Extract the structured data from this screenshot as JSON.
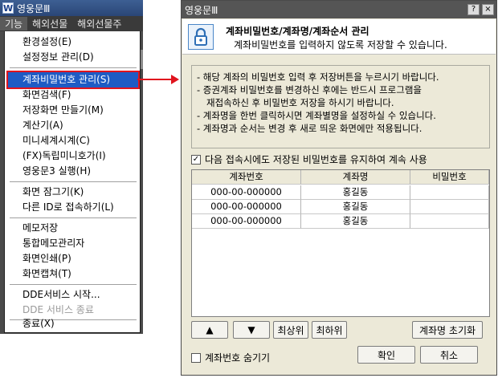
{
  "app": {
    "title": "영웅문Ⅲ",
    "logo": "W",
    "menubar": [
      "기능",
      "해외선물",
      "해외선물주"
    ],
    "menu_items": [
      {
        "label": "환경설정(E)",
        "key": "env"
      },
      {
        "label": "설정정보 관리(D)",
        "key": "config"
      },
      {
        "label": "계좌비밀번호 관리(S)",
        "key": "acct-pw",
        "selected": true
      },
      {
        "label": "화면검색(F)",
        "key": "screen-search"
      },
      {
        "label": "저장화면 만들기(M)",
        "key": "save-screen"
      },
      {
        "label": "계산기(A)",
        "key": "calculator"
      },
      {
        "label": "미니세계시계(C)",
        "key": "world-clock"
      },
      {
        "label": "(FX)독립미니호가(I)",
        "key": "fx-mini"
      },
      {
        "label": "영웅문3 실행(H)",
        "key": "run-hero3"
      },
      {
        "label": "화면 잠그기(K)",
        "key": "lock-screen"
      },
      {
        "label": "다른 ID로 접속하기(L)",
        "key": "other-id"
      },
      {
        "label": "메모저장",
        "key": "memo-save"
      },
      {
        "label": "통합메모관리자",
        "key": "memo-manager"
      },
      {
        "label": "화면인쇄(P)",
        "key": "print"
      },
      {
        "label": "화면캡쳐(T)",
        "key": "capture"
      },
      {
        "label": "DDE서비스 시작...",
        "key": "dde-start"
      },
      {
        "label": "DDE 서비스 종료",
        "key": "dde-stop",
        "disabled": true
      },
      {
        "label": "종료(X)",
        "key": "exit"
      }
    ]
  },
  "dialog": {
    "title": "영웅문Ⅲ",
    "heading": "계좌비밀번호/계좌명/계좌순서 관리",
    "subheading": "계좌비밀번호를 입력하지 않도록 저장할 수 있습니다.",
    "info_lines": [
      "- 해당 계좌의 비밀번호 입력 후 저장버튼을 누르시기 바랍니다.",
      "- 증권계좌 비밀번호를 변경하신 후에는 반드시 프로그램을",
      "재접속하신 후 비밀번호 저장을 하시기 바랍니다.",
      "- 계좌명을 한번 클릭하시면 계좌별명을 설정하실 수 있습니다.",
      "- 계좌명과 순서는 변경 후 새로 띄운 화면에만 적용됩니다."
    ],
    "keep_option": {
      "label": "다음 접속시에도 저장된 비밀번호를 유지하여 계속 사용",
      "checked": true
    },
    "table": {
      "columns": [
        "계좌번호",
        "계좌명",
        "비밀번호"
      ],
      "rows": [
        [
          "000-00-000000",
          "홍길동",
          ""
        ],
        [
          "000-00-000000",
          "홍길동",
          ""
        ],
        [
          "000-00-000000",
          "홍길동",
          ""
        ]
      ]
    },
    "buttons": {
      "up": "▲",
      "down": "▼",
      "top": "최상위",
      "bottom": "최하위",
      "reset_names": "계좌명 초기화",
      "ok": "확인",
      "cancel": "취소",
      "help": "?",
      "close": "×"
    },
    "hide_option": {
      "label": "계좌번호 숨기기",
      "checked": false
    }
  }
}
